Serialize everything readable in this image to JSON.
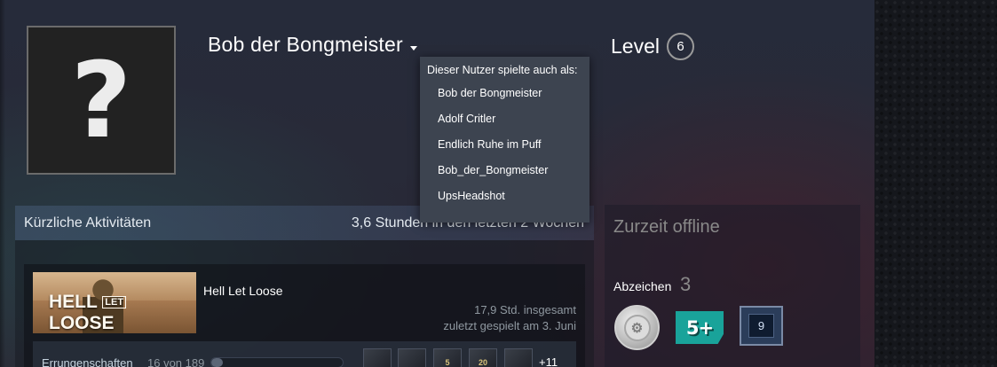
{
  "profile": {
    "avatar_glyph": "?",
    "persona_name": "Bob der Bongmeister",
    "level_label": "Level",
    "level_value": "6"
  },
  "alias_menu": {
    "header": "Dieser Nutzer spielte auch als:",
    "items": [
      "Bob der Bongmeister",
      "Adolf Critler",
      "Endlich Ruhe im Puff",
      "Bob_der_Bongmeister",
      "UpsHeadshot"
    ]
  },
  "activity": {
    "title": "Kürzliche Aktivitäten",
    "hours_summary": "3,6 Stunden in den letzten 2 Wochen"
  },
  "game": {
    "name": "Hell Let Loose",
    "capsule_logo_a": "HELL",
    "capsule_logo_b": "LET",
    "capsule_logo_c": "LOOSE",
    "playtime": "17,9 Std. insgesamt",
    "last_played": "zuletzt gespielt am 3. Juni",
    "achievements_label": "Errungenschaften",
    "achievements_count": "16 von 189",
    "achievements_progress": 0.085,
    "achievement_icons": [
      "medal-icon",
      "helmet-icon",
      "badge-5-icon",
      "badge-20-icon",
      "crossed-rifles-icon"
    ],
    "achievement_icon_texts": [
      "",
      "",
      "5",
      "20",
      ""
    ],
    "achievements_more": "+11"
  },
  "sidebar": {
    "status": "Zurzeit offline",
    "badges_label": "Abzeichen",
    "badges_count": "3",
    "badge_years_text": "5+",
    "badge_games_text": "9"
  },
  "colors": {
    "teal_badge": "#19a39a",
    "menu_bg": "#3d4450",
    "status_gray": "#898989"
  }
}
